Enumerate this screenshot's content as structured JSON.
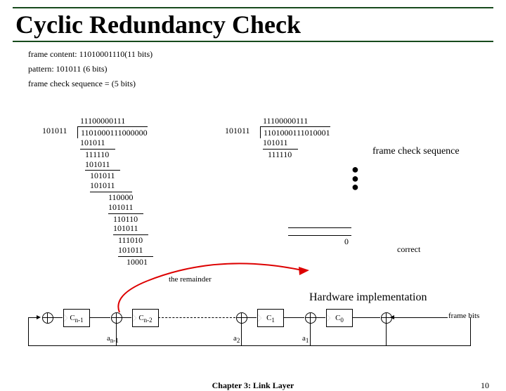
{
  "title": "Cyclic Redundancy Check",
  "info": {
    "frame_content": "frame content: 11010001110(11 bits)",
    "pattern": "pattern: 101011 (6 bits)",
    "fcs": "frame check sequence = (5 bits)"
  },
  "left_calc": {
    "quotient": "11100000111",
    "divisor": "101011",
    "dividend": "1101000111000000",
    "steps": [
      "101011",
      "111110",
      "101011",
      "101011",
      "101011",
      "110000",
      "101011",
      "110110",
      "101011",
      "111010",
      "101011"
    ],
    "remainder": "10001"
  },
  "right_calc": {
    "quotient": "11100000111",
    "divisor": "101011",
    "dividend": "1101000111010001",
    "steps_top": [
      "101011",
      "111110"
    ],
    "final": "0"
  },
  "labels": {
    "frame_check_seq": "frame check sequence",
    "correct": "correct",
    "remainder": "the remainder",
    "hw": "Hardware implementation",
    "frame_bits": "frame bits"
  },
  "hw": {
    "c_n1": "C",
    "c_n1_sub": "n-1",
    "c_n2": "C",
    "c_n2_sub": "n-2",
    "c_1": "C",
    "c_1_sub": "1",
    "c_0": "C",
    "c_0_sub": "0",
    "a_n1": "a",
    "a_n1_sub": "n-1",
    "a_2": "a",
    "a_2_sub": "2",
    "a_1": "a",
    "a_1_sub": "1"
  },
  "footer": {
    "center": "Chapter 3: Link Layer",
    "page": "10"
  }
}
